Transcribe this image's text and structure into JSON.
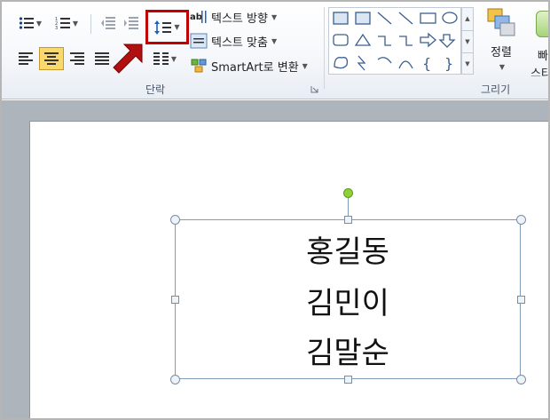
{
  "ribbon": {
    "paragraph_group_label": "단락",
    "drawing_group_label": "그리기",
    "text_direction_label": "텍스트 방향",
    "align_text_label": "텍스트 맞춤",
    "smartart_label": "SmartArt로 변환",
    "arrange_label": "정렬",
    "quick_styles_partial": "빠",
    "quick_styles_partial2": "스타"
  },
  "slide": {
    "lines": [
      "홍길동",
      "김민이",
      "김말순"
    ]
  },
  "colors": {
    "highlight_box": "#c00000",
    "callout_arrow": "#b01010",
    "active_button_bg": "#fbd86b",
    "rotation_handle": "#8fcf3c"
  },
  "icons": [
    "bullets-icon",
    "numbering-icon",
    "decrease-indent-icon",
    "increase-indent-icon",
    "line-spacing-icon",
    "text-direction-icon",
    "align-text-icon",
    "smartart-icon",
    "align-left-icon",
    "align-center-icon",
    "align-right-icon",
    "justify-icon",
    "columns-icon",
    "dialog-launcher-icon",
    "arrange-icon"
  ]
}
